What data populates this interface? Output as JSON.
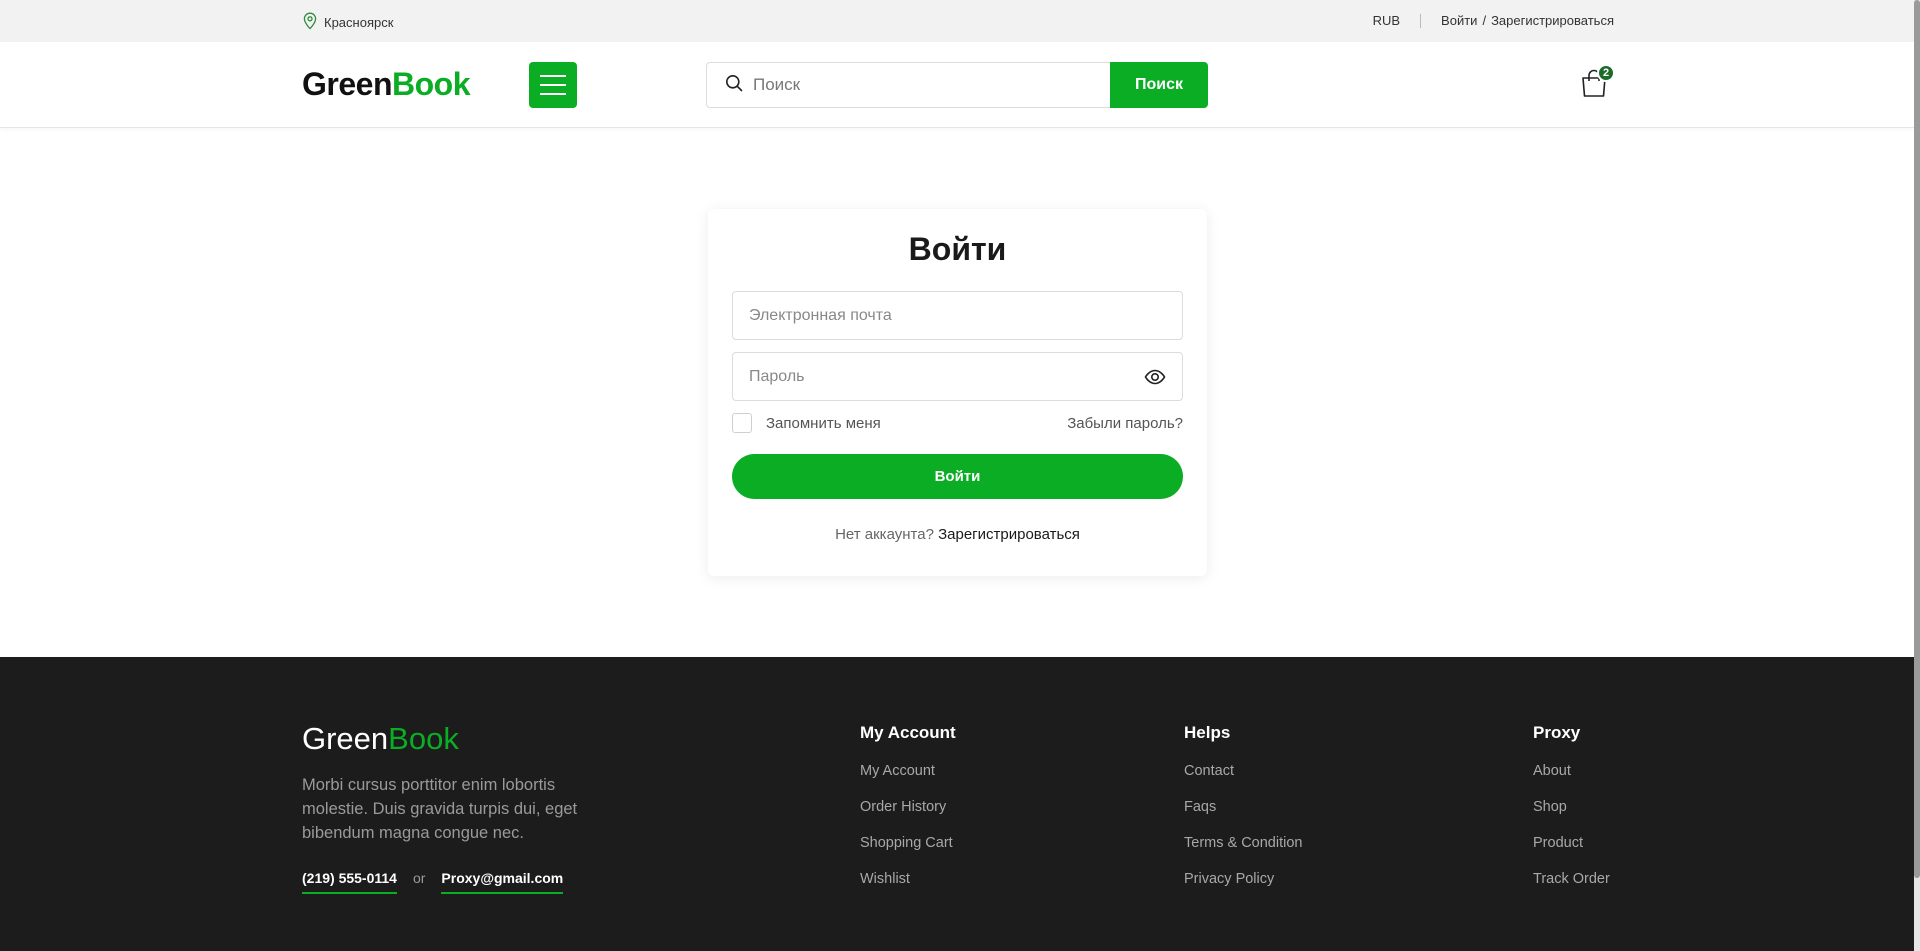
{
  "topbar": {
    "location": "Красноярск",
    "currency": "RUB",
    "login": "Войти",
    "slash": "/",
    "register": "Зарегистрироваться"
  },
  "header": {
    "logo_part1": "Green",
    "logo_part2": "Book",
    "search_placeholder": "Поиск",
    "search_button": "Поиск",
    "cart_count": "2"
  },
  "login": {
    "title": "Войти",
    "email_placeholder": "Электронная почта",
    "password_placeholder": "Пароль",
    "remember": "Запомнить меня",
    "forgot": "Забыли пароль?",
    "submit": "Войти",
    "no_account": "Нет аккаунта?",
    "register": "Зарегистрироваться"
  },
  "footer": {
    "logo_part1": "Green",
    "logo_part2": "Book",
    "description": "Morbi cursus porttitor enim lobortis molestie. Duis gravida turpis dui, eget bibendum magna congue nec.",
    "phone": "(219) 555-0114",
    "or": "or",
    "email": "Proxy@gmail.com",
    "columns": [
      {
        "title": "My Account",
        "links": [
          "My Account",
          "Order History",
          "Shopping Cart",
          "Wishlist"
        ]
      },
      {
        "title": "Helps",
        "links": [
          "Contact",
          "Faqs",
          "Terms & Condition",
          "Privacy Policy"
        ]
      },
      {
        "title": "Proxy",
        "links": [
          "About",
          "Shop",
          "Product",
          "Track Order"
        ]
      }
    ]
  },
  "colors": {
    "accent": "#0aad24",
    "footer_bg": "#1c1c1c",
    "topbar_bg": "#f2f2f2"
  },
  "icons": [
    "location-pin-icon",
    "menu-icon",
    "search-icon",
    "shopping-bag-icon",
    "eye-icon"
  ]
}
